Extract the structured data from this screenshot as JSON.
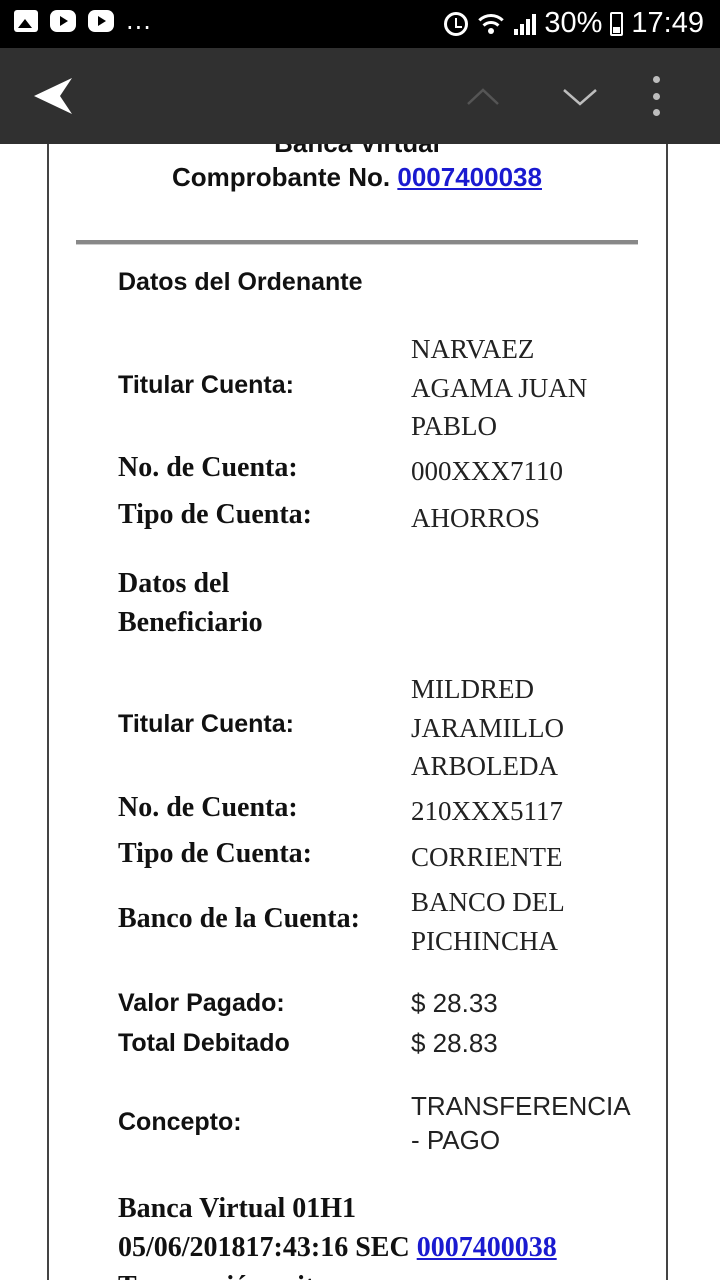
{
  "status_bar": {
    "battery": "30%",
    "time": "17:49",
    "more": "..."
  },
  "toolbar": {
    "icons": [
      "back-arrow-icon",
      "chevron-up-icon",
      "chevron-down-icon",
      "overflow-menu-icon"
    ]
  },
  "document": {
    "bank_title": "Banca Virtual",
    "comprobante_label": "Comprobante No.",
    "comprobante_number": "0007400038",
    "ordenante": {
      "heading": "Datos del Ordenante",
      "titular_label": "Titular Cuenta:",
      "titular_value": [
        "NARVAEZ",
        "AGAMA JUAN",
        "PABLO"
      ],
      "cuenta_label": "No. de Cuenta:",
      "cuenta_value": "000XXX7110",
      "tipo_label": "Tipo de Cuenta:",
      "tipo_value": "AHORROS"
    },
    "beneficiario": {
      "heading_line1": "Datos del",
      "heading_line2": "Beneficiario",
      "titular_label": "Titular Cuenta:",
      "titular_value": [
        "MILDRED",
        "JARAMILLO",
        "ARBOLEDA"
      ],
      "cuenta_label": "No. de Cuenta:",
      "cuenta_value": "210XXX5117",
      "tipo_label": "Tipo de Cuenta:",
      "tipo_value": "CORRIENTE",
      "banco_label": "Banco de la Cuenta:",
      "banco_value": [
        "BANCO DEL",
        "PICHINCHA"
      ]
    },
    "valor_label": "Valor Pagado:",
    "valor_value": "$ 28.33",
    "total_label": "Total Debitado",
    "total_value": "$ 28.83",
    "concepto_label": "Concepto:",
    "concepto_value": [
      "TRANSFERENCIA",
      "- PAGO"
    ],
    "footer_line1": "Banca Virtual 01H1",
    "footer_line2_text": "05/06/201817:43:16 SEC",
    "footer_line2_link": "0007400038",
    "footer_line3": "Transacción exitosa"
  }
}
